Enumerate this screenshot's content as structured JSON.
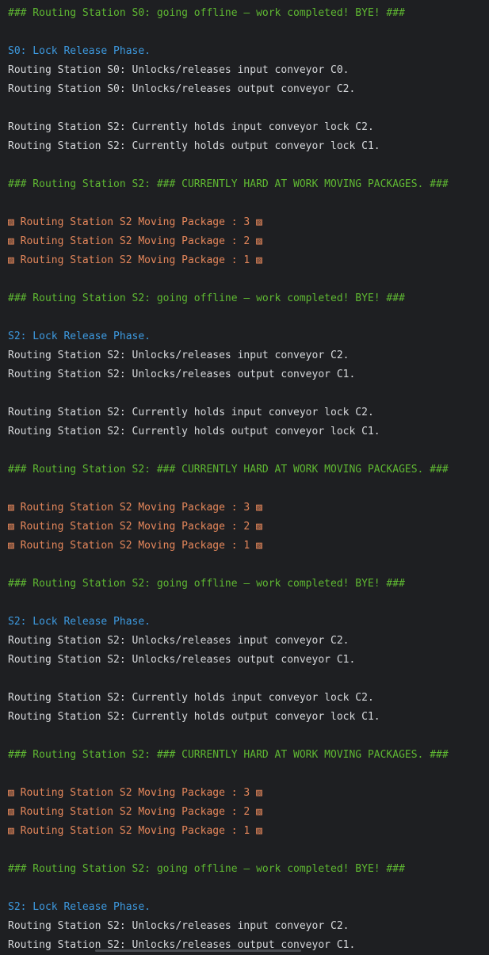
{
  "console": {
    "lines": [
      {
        "text": "### Routing Station S0: going offline – work completed! BYE! ###",
        "kind": "green"
      },
      {
        "text": "",
        "kind": "blank"
      },
      {
        "text": "S0: Lock Release Phase.",
        "kind": "blue"
      },
      {
        "text": "Routing Station S0: Unlocks/releases input conveyor C0.",
        "kind": "white"
      },
      {
        "text": "Routing Station S0: Unlocks/releases output conveyor C2.",
        "kind": "white"
      },
      {
        "text": "",
        "kind": "blank"
      },
      {
        "text": "Routing Station S2: Currently holds input conveyor lock C2.",
        "kind": "white"
      },
      {
        "text": "Routing Station S2: Currently holds output conveyor lock C1.",
        "kind": "white"
      },
      {
        "text": "",
        "kind": "blank"
      },
      {
        "text": "### Routing Station S2: ### CURRENTLY HARD AT WORK MOVING PACKAGES. ###",
        "kind": "green"
      },
      {
        "text": "",
        "kind": "blank"
      },
      {
        "text": "▨ Routing Station S2 Moving Package : 3 ▨",
        "kind": "orange"
      },
      {
        "text": "▨ Routing Station S2 Moving Package : 2 ▨",
        "kind": "orange"
      },
      {
        "text": "▨ Routing Station S2 Moving Package : 1 ▨",
        "kind": "orange"
      },
      {
        "text": "",
        "kind": "blank"
      },
      {
        "text": "### Routing Station S2: going offline – work completed! BYE! ###",
        "kind": "green"
      },
      {
        "text": "",
        "kind": "blank"
      },
      {
        "text": "S2: Lock Release Phase.",
        "kind": "blue"
      },
      {
        "text": "Routing Station S2: Unlocks/releases input conveyor C2.",
        "kind": "white"
      },
      {
        "text": "Routing Station S2: Unlocks/releases output conveyor C1.",
        "kind": "white"
      },
      {
        "text": "",
        "kind": "blank"
      },
      {
        "text": "Routing Station S2: Currently holds input conveyor lock C2.",
        "kind": "white"
      },
      {
        "text": "Routing Station S2: Currently holds output conveyor lock C1.",
        "kind": "white"
      },
      {
        "text": "",
        "kind": "blank"
      },
      {
        "text": "### Routing Station S2: ### CURRENTLY HARD AT WORK MOVING PACKAGES. ###",
        "kind": "green"
      },
      {
        "text": "",
        "kind": "blank"
      },
      {
        "text": "▨ Routing Station S2 Moving Package : 3 ▨",
        "kind": "orange"
      },
      {
        "text": "▨ Routing Station S2 Moving Package : 2 ▨",
        "kind": "orange"
      },
      {
        "text": "▨ Routing Station S2 Moving Package : 1 ▨",
        "kind": "orange"
      },
      {
        "text": "",
        "kind": "blank"
      },
      {
        "text": "### Routing Station S2: going offline – work completed! BYE! ###",
        "kind": "green"
      },
      {
        "text": "",
        "kind": "blank"
      },
      {
        "text": "S2: Lock Release Phase.",
        "kind": "blue"
      },
      {
        "text": "Routing Station S2: Unlocks/releases input conveyor C2.",
        "kind": "white"
      },
      {
        "text": "Routing Station S2: Unlocks/releases output conveyor C1.",
        "kind": "white"
      },
      {
        "text": "",
        "kind": "blank"
      },
      {
        "text": "Routing Station S2: Currently holds input conveyor lock C2.",
        "kind": "white"
      },
      {
        "text": "Routing Station S2: Currently holds output conveyor lock C1.",
        "kind": "white"
      },
      {
        "text": "",
        "kind": "blank"
      },
      {
        "text": "### Routing Station S2: ### CURRENTLY HARD AT WORK MOVING PACKAGES. ###",
        "kind": "green"
      },
      {
        "text": "",
        "kind": "blank"
      },
      {
        "text": "▨ Routing Station S2 Moving Package : 3 ▨",
        "kind": "orange"
      },
      {
        "text": "▨ Routing Station S2 Moving Package : 2 ▨",
        "kind": "orange"
      },
      {
        "text": "▨ Routing Station S2 Moving Package : 1 ▨",
        "kind": "orange"
      },
      {
        "text": "",
        "kind": "blank"
      },
      {
        "text": "### Routing Station S2: going offline – work completed! BYE! ###",
        "kind": "green"
      },
      {
        "text": "",
        "kind": "blank"
      },
      {
        "text": "S2: Lock Release Phase.",
        "kind": "blue"
      },
      {
        "text": "Routing Station S2: Unlocks/releases input conveyor C2.",
        "kind": "white"
      },
      {
        "text": "Routing Station S2: Unlocks/releases output conveyor C1.",
        "kind": "white"
      }
    ]
  },
  "colors": {
    "background": "#1e1f22",
    "green": "#5fb832",
    "blue": "#3d9ae0",
    "white": "#d6d8db",
    "orange": "#e5875b"
  }
}
